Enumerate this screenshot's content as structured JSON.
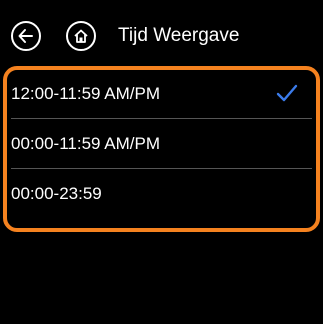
{
  "header": {
    "title": "Tijd Weergave",
    "back_icon": "back-arrow-icon",
    "home_icon": "home-icon"
  },
  "time_format_options": [
    {
      "label": "12:00-11:59 AM/PM",
      "selected": true
    },
    {
      "label": "00:00-11:59 AM/PM",
      "selected": false
    },
    {
      "label": "00:00-23:59",
      "selected": false
    }
  ],
  "colors": {
    "background": "#000000",
    "text": "#ffffff",
    "highlight": "#f5821f",
    "check": "#3b7bea",
    "divider": "#555555"
  }
}
